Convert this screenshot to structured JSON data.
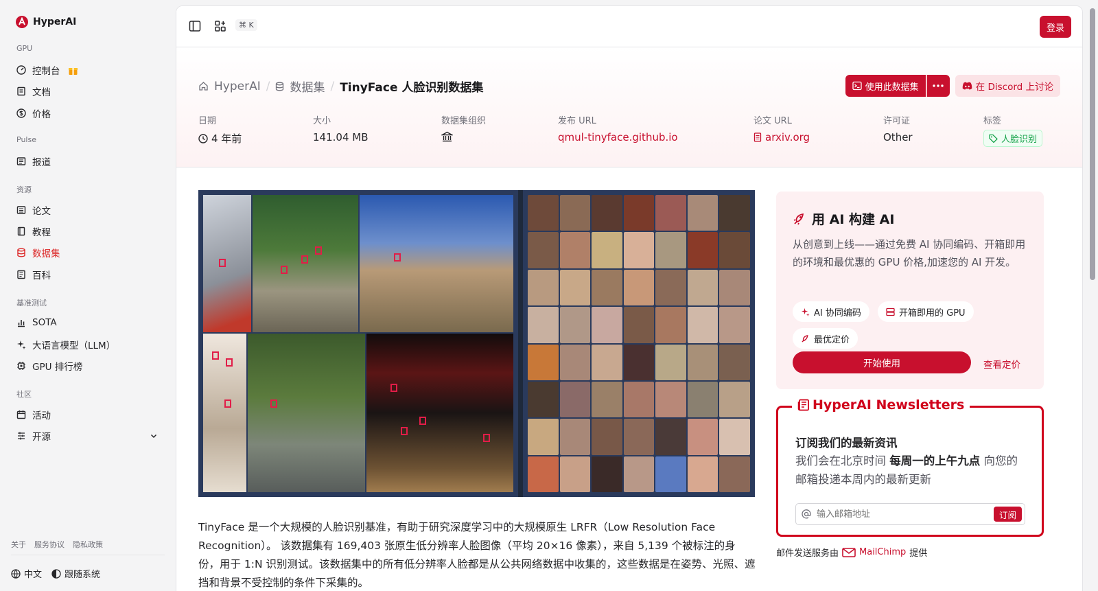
{
  "brand": {
    "name": "HyperAI",
    "accent": "#c8102e"
  },
  "sidebar": {
    "sections": [
      {
        "label": "GPU",
        "items": [
          {
            "label": "控制台",
            "icon": "gauge-icon"
          },
          {
            "label": "文档",
            "icon": "doc-icon"
          },
          {
            "label": "价格",
            "icon": "dollar-icon"
          }
        ]
      },
      {
        "label": "Pulse",
        "items": [
          {
            "label": "报道",
            "icon": "news-icon"
          }
        ]
      },
      {
        "label": "资源",
        "items": [
          {
            "label": "论文",
            "icon": "paper-icon"
          },
          {
            "label": "教程",
            "icon": "book-icon"
          },
          {
            "label": "数据集",
            "icon": "database-icon"
          },
          {
            "label": "百科",
            "icon": "encyclopedia-icon"
          }
        ]
      },
      {
        "label": "基准测试",
        "items": [
          {
            "label": "SOTA",
            "icon": "bar-chart-icon"
          },
          {
            "label": "大语言模型（LLM）",
            "icon": "sparkle-icon"
          },
          {
            "label": "GPU 排行榜",
            "icon": "chip-icon"
          }
        ]
      },
      {
        "label": "社区",
        "items": [
          {
            "label": "活动",
            "icon": "calendar-icon"
          },
          {
            "label": "开源",
            "icon": "list-icon"
          }
        ]
      }
    ],
    "footer_links": [
      "关于",
      "服务协议",
      "隐私政策"
    ],
    "language": "中文",
    "theme": "跟随系统"
  },
  "topbar": {
    "kbd": "⌘ K",
    "login": "登录"
  },
  "breadcrumb": {
    "home": "HyperAI",
    "section": "数据集",
    "current": "TinyFace 人脸识别数据集"
  },
  "actions": {
    "use_dataset": "使用此数据集",
    "discord": "在 Discord 上讨论"
  },
  "meta": {
    "date_label": "日期",
    "date_value": "4 年前",
    "size_label": "大小",
    "size_value": "141.04 MB",
    "org_label": "数据集组织",
    "url_label": "发布 URL",
    "url_value": "qmul-tinyface.github.io",
    "paper_label": "论文 URL",
    "paper_value": "arxiv.org",
    "license_label": "许可证",
    "license_value": "Other",
    "tags_label": "标签",
    "tag_value": "人脸识别"
  },
  "description": "TinyFace 是一个大规模的人脸识别基准，有助于研究深度学习中的大规模原生 LRFR（Low Resolution Face Recognition）。 该数据集有 169,403 张原生低分辨率人脸图像（平均 20×16 像素），来自 5,139 个被标注的身份，用于 1:N 识别测试。该数据集中的所有低分辨率人脸都是从公共网络数据中收集的，这些数据是在姿势、光照、遮挡和背景不受控制的条件下采集的。",
  "promo": {
    "title": "用 AI 构建 AI",
    "desc": "从创意到上线——通过免费 AI 协同编码、开箱即用的环境和最优惠的 GPU 价格,加速您的 AI 开发。",
    "chips": [
      "AI 协同编码",
      "开箱即用的 GPU",
      "最优定价"
    ],
    "start": "开始使用",
    "pricing": "查看定价"
  },
  "newsletter": {
    "title": "HyperAI Newsletters",
    "heading": "订阅我们的最新资讯",
    "text_pre": "我们会在北京时间 ",
    "text_bold": "每周一的上午九点",
    "text_post": " 向您的邮箱投递本周内的最新更新",
    "placeholder": "输入邮箱地址",
    "subscribe": "订阅",
    "mail_pre": "邮件发送服务由",
    "mail_brand": "MailChimp",
    "mail_post": "提供"
  }
}
